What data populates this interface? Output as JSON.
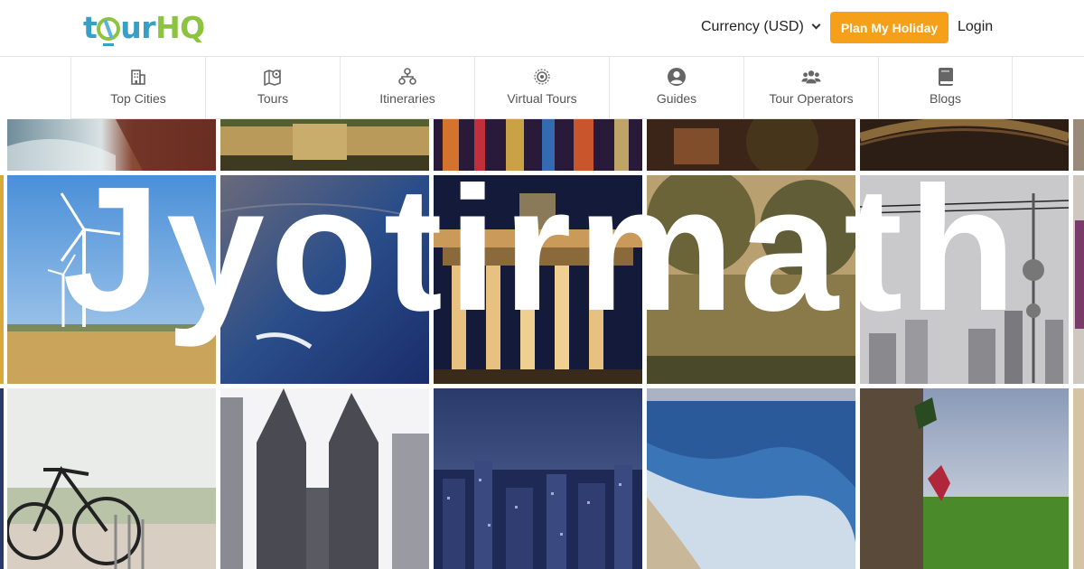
{
  "header": {
    "currency_label": "Currency (USD)",
    "plan_button": "Plan My Holiday",
    "login": "Login"
  },
  "logo": {
    "part1": "t",
    "part2": "ur",
    "part3": "HQ",
    "icon": "globe-icon"
  },
  "nav": {
    "items": [
      {
        "label": "Top Cities",
        "icon": "city-building-icon"
      },
      {
        "label": "Tours",
        "icon": "map-pin-icon"
      },
      {
        "label": "Itineraries",
        "icon": "route-nodes-icon"
      },
      {
        "label": "Virtual Tours",
        "icon": "virtual-tour-icon"
      },
      {
        "label": "Guides",
        "icon": "person-circle-icon"
      },
      {
        "label": "Tour Operators",
        "icon": "group-users-icon"
      },
      {
        "label": "Blogs",
        "icon": "book-icon"
      }
    ]
  },
  "hero": {
    "title": "Jyotirmath"
  },
  "colors": {
    "accent": "#f6a01a",
    "logo_blue": "#3a9fc4",
    "logo_green": "#8cc43f"
  }
}
